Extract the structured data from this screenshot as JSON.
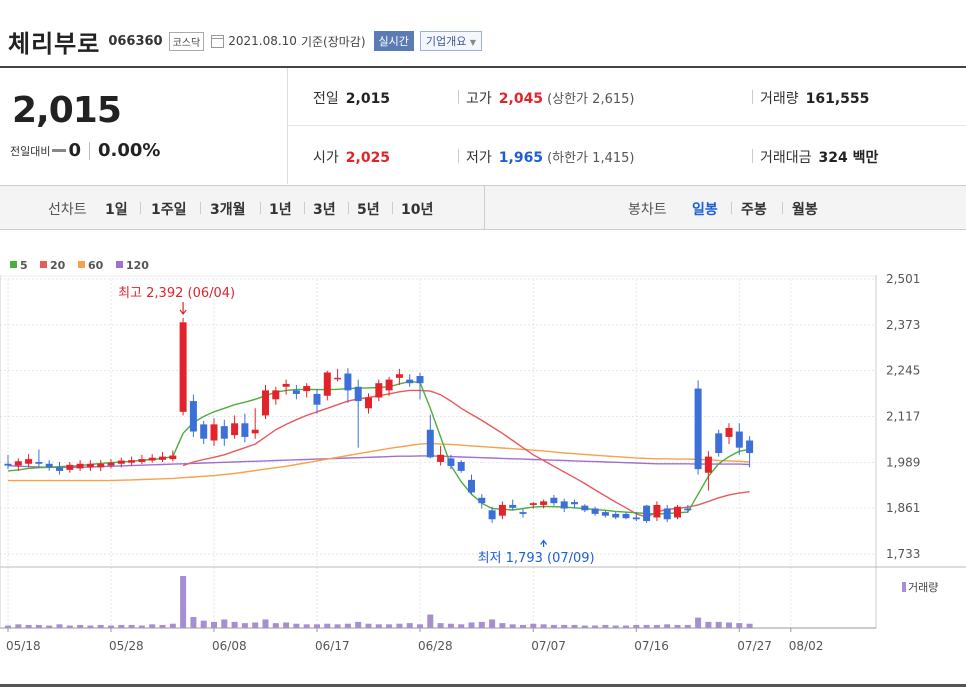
{
  "header": {
    "stock_name": "체리부로",
    "stock_code": "066360",
    "market": "코스닥",
    "date": "2021.08.10",
    "basis": "기준(장마감)",
    "realtime_label": "실시간",
    "company_info_label": "기업개요"
  },
  "quote": {
    "price": "2,015",
    "change_label": "전일대비",
    "change_value": "0",
    "change_pct": "0.00%",
    "prev_close_label": "전일",
    "prev_close": "2,015",
    "high_label": "고가",
    "high": "2,045",
    "upper_limit_label": "상한가",
    "upper_limit": "2,615",
    "volume_label": "거래량",
    "volume": "161,555",
    "open_label": "시가",
    "open": "2,025",
    "low_label": "저가",
    "low": "1,965",
    "lower_limit_label": "하한가",
    "lower_limit": "1,415",
    "trade_value_label": "거래대금",
    "trade_value": "324 백만"
  },
  "tabs": {
    "line_label": "선차트",
    "line_periods": [
      "1일",
      "1주일",
      "3개월",
      "1년",
      "3년",
      "5년",
      "10년"
    ],
    "candle_label": "봉차트",
    "candle_periods": [
      "일봉",
      "주봉",
      "월봉"
    ],
    "active_candle": "일봉"
  },
  "colors": {
    "up": "#e3232b",
    "down": "#3c6fd8",
    "ma5": "#4caf3c",
    "ma20": "#e85a5a",
    "ma60": "#f5a24a",
    "ma120": "#a070d0",
    "volume": "#a58fd0",
    "max_label": "#e3232b",
    "min_label": "#1e5fd6"
  },
  "chart_data": {
    "type": "candlestick",
    "legend": [
      "5",
      "20",
      "60",
      "120"
    ],
    "ylim": [
      1733,
      2501
    ],
    "y_ticks": [
      "2,501",
      "2,373",
      "2,245",
      "2,117",
      "1,989",
      "1,861",
      "1,733"
    ],
    "x_ticks": [
      {
        "label": "05/18",
        "i": 0
      },
      {
        "label": "05/28",
        "i": 10
      },
      {
        "label": "06/08",
        "i": 20
      },
      {
        "label": "06/17",
        "i": 30
      },
      {
        "label": "06/28",
        "i": 40
      },
      {
        "label": "07/07",
        "i": 51
      },
      {
        "label": "07/16",
        "i": 61
      },
      {
        "label": "07/27",
        "i": 71
      },
      {
        "label": "08/02",
        "i": 76
      }
    ],
    "annotations": {
      "max": {
        "text": "최고 2,392 (06/04)",
        "i": 17,
        "value": 2392
      },
      "min": {
        "text": "최저 1,793 (07/09)",
        "i": 52,
        "value": 1793
      }
    },
    "volume_label": "거래량",
    "ohlc": [
      [
        1985,
        2010,
        1970,
        1980
      ],
      [
        1980,
        2000,
        1965,
        1992
      ],
      [
        1985,
        2012,
        1975,
        1998
      ],
      [
        1990,
        2025,
        1975,
        1985
      ],
      [
        1985,
        1995,
        1965,
        1975
      ],
      [
        1975,
        1990,
        1955,
        1965
      ],
      [
        1968,
        1990,
        1960,
        1982
      ],
      [
        1972,
        1995,
        1965,
        1985
      ],
      [
        1975,
        1995,
        1965,
        1985
      ],
      [
        1975,
        1995,
        1965,
        1985
      ],
      [
        1980,
        1998,
        1972,
        1988
      ],
      [
        1985,
        2002,
        1975,
        1994
      ],
      [
        1988,
        2005,
        1980,
        1995
      ],
      [
        1990,
        2010,
        1984,
        1998
      ],
      [
        1994,
        2012,
        1988,
        2002
      ],
      [
        1996,
        2018,
        1990,
        2005
      ],
      [
        1998,
        2022,
        1992,
        2008
      ],
      [
        2130,
        2392,
        2120,
        2380
      ],
      [
        2160,
        2178,
        2060,
        2075
      ],
      [
        2095,
        2105,
        2040,
        2055
      ],
      [
        2050,
        2112,
        2035,
        2095
      ],
      [
        2090,
        2108,
        2035,
        2055
      ],
      [
        2065,
        2120,
        2055,
        2098
      ],
      [
        2098,
        2125,
        2045,
        2060
      ],
      [
        2070,
        2140,
        2055,
        2080
      ],
      [
        2120,
        2205,
        2110,
        2190
      ],
      [
        2165,
        2200,
        2150,
        2190
      ],
      [
        2200,
        2220,
        2178,
        2208
      ],
      [
        2190,
        2205,
        2165,
        2180
      ],
      [
        2188,
        2210,
        2170,
        2202
      ],
      [
        2180,
        2192,
        2125,
        2150
      ],
      [
        2175,
        2245,
        2162,
        2240
      ],
      [
        2225,
        2250,
        2215,
        2225
      ],
      [
        2237,
        2252,
        2155,
        2190
      ],
      [
        2200,
        2220,
        2030,
        2160
      ],
      [
        2140,
        2182,
        2125,
        2170
      ],
      [
        2170,
        2220,
        2160,
        2210
      ],
      [
        2190,
        2228,
        2175,
        2220
      ],
      [
        2225,
        2250,
        2205,
        2235
      ],
      [
        2220,
        2235,
        2200,
        2210
      ],
      [
        2230,
        2239,
        2165,
        2210
      ],
      [
        2080,
        2122,
        2000,
        2003
      ],
      [
        1990,
        2035,
        1980,
        2010
      ],
      [
        2000,
        2010,
        1970,
        1979
      ],
      [
        1990,
        1995,
        1960,
        1965
      ],
      [
        1940,
        1955,
        1900,
        1905
      ],
      [
        1890,
        1900,
        1860,
        1875
      ],
      [
        1855,
        1865,
        1820,
        1830
      ],
      [
        1840,
        1880,
        1830,
        1870
      ],
      [
        1870,
        1885,
        1855,
        1862
      ],
      [
        1850,
        1860,
        1835,
        1845
      ],
      [
        1870,
        1878,
        1860,
        1875
      ],
      [
        1870,
        1885,
        1860,
        1880
      ],
      [
        1890,
        1898,
        1868,
        1875
      ],
      [
        1880,
        1888,
        1850,
        1860
      ],
      [
        1878,
        1885,
        1860,
        1872
      ],
      [
        1868,
        1872,
        1850,
        1855
      ],
      [
        1860,
        1865,
        1840,
        1845
      ],
      [
        1850,
        1855,
        1835,
        1840
      ],
      [
        1845,
        1850,
        1830,
        1835
      ],
      [
        1845,
        1850,
        1830,
        1833
      ],
      [
        1835,
        1850,
        1825,
        1830
      ],
      [
        1868,
        1870,
        1820,
        1825
      ],
      [
        1835,
        1880,
        1825,
        1870
      ],
      [
        1860,
        1870,
        1822,
        1830
      ],
      [
        1835,
        1870,
        1830,
        1865
      ],
      [
        1860,
        1870,
        1848,
        1855
      ],
      [
        2195,
        2218,
        1955,
        1970
      ],
      [
        1960,
        2020,
        1910,
        2005
      ],
      [
        2070,
        2080,
        2005,
        2015
      ],
      [
        2060,
        2098,
        2040,
        2085
      ],
      [
        2075,
        2098,
        2010,
        2030
      ],
      [
        2050,
        2062,
        1975,
        2015
      ]
    ],
    "volume": [
      4,
      6,
      5,
      5,
      4,
      6,
      4,
      5,
      4,
      5,
      4,
      5,
      5,
      4,
      6,
      5,
      7,
      85,
      18,
      12,
      10,
      14,
      10,
      8,
      9,
      14,
      8,
      9,
      7,
      6,
      6,
      7,
      6,
      7,
      10,
      7,
      6,
      6,
      7,
      8,
      6,
      22,
      8,
      7,
      6,
      9,
      10,
      14,
      8,
      6,
      5,
      7,
      6,
      5,
      5,
      5,
      4,
      4,
      5,
      4,
      4,
      5,
      5,
      5,
      6,
      5,
      5,
      17,
      10,
      10,
      9,
      8,
      7
    ],
    "ma5": [
      1965,
      1968,
      1972,
      1974,
      1975,
      1977,
      1978,
      1980,
      1983,
      1986,
      1988,
      1990,
      1992,
      1995,
      1997,
      2000,
      2005,
      2070,
      2100,
      2117,
      2130,
      2140,
      2150,
      2157,
      2165,
      2175,
      2185,
      2190,
      2192,
      2193,
      2192,
      2192,
      2193,
      2195,
      2196,
      2197,
      2198,
      2200,
      2208,
      2215,
      2212,
      2140,
      2060,
      1980,
      1935,
      1900,
      1875,
      1860,
      1858,
      1856,
      1860,
      1864,
      1866,
      1865,
      1864,
      1862,
      1860,
      1857,
      1855,
      1852,
      1850,
      1848,
      1846,
      1845,
      1846,
      1848,
      1850,
      1900,
      1950,
      1985,
      2005,
      2020,
      2025
    ],
    "ma20": [
      null,
      null,
      null,
      null,
      null,
      null,
      null,
      null,
      null,
      null,
      null,
      null,
      null,
      null,
      null,
      null,
      null,
      1980,
      1990,
      1997,
      2003,
      2010,
      2020,
      2030,
      2040,
      2060,
      2080,
      2095,
      2108,
      2120,
      2130,
      2140,
      2150,
      2160,
      2166,
      2170,
      2175,
      2180,
      2186,
      2190,
      2190,
      2188,
      2178,
      2160,
      2140,
      2123,
      2106,
      2088,
      2070,
      2050,
      2030,
      2010,
      1994,
      1978,
      1962,
      1946,
      1930,
      1912,
      1895,
      1878,
      1862,
      1845,
      1836,
      1850,
      1858,
      1860,
      1864,
      1870,
      1880,
      1890,
      1898,
      1903,
      1907
    ],
    "ma60": [
      1938,
      1938,
      1938,
      1938,
      1938,
      1938,
      1938,
      1938,
      1938,
      1938,
      1938,
      1939,
      1940,
      1941,
      1942,
      1943,
      1944,
      1946,
      1948,
      1950,
      1952,
      1955,
      1958,
      1962,
      1966,
      1970,
      1974,
      1978,
      1983,
      1988,
      1993,
      1998,
      2003,
      2008,
      2013,
      2018,
      2023,
      2028,
      2032,
      2036,
      2040,
      2042,
      2040,
      2039,
      2037,
      2035,
      2033,
      2031,
      2029,
      2027,
      2025,
      2023,
      2021,
      2018,
      2015,
      2013,
      2011,
      2009,
      2007,
      2005,
      2003,
      2001,
      2000,
      1999,
      1999,
      1998,
      1998,
      1997,
      1996,
      1994,
      1993,
      1992,
      1990
    ],
    "ma120": [
      1980,
      1978,
      1977,
      1976,
      1975,
      1975,
      1975,
      1975,
      1976,
      1977,
      1978,
      1979,
      1980,
      1981,
      1982,
      1983,
      1984,
      1985,
      1986,
      1987,
      1988,
      1989,
      1990,
      1991,
      1992,
      1993,
      1994,
      1995,
      1996,
      1997,
      1998,
      1999,
      2000,
      2001,
      2002,
      2003,
      2004,
      2005,
      2006,
      2006,
      2007,
      2007,
      2006,
      2005,
      2004,
      2003,
      2002,
      2001,
      2000,
      1999,
      1998,
      1997,
      1996,
      1995,
      1994,
      1993,
      1992,
      1991,
      1990,
      1989,
      1988,
      1987,
      1986,
      1985,
      1985,
      1985,
      1985,
      1984,
      1984,
      1984,
      1984,
      1984,
      1983
    ]
  }
}
